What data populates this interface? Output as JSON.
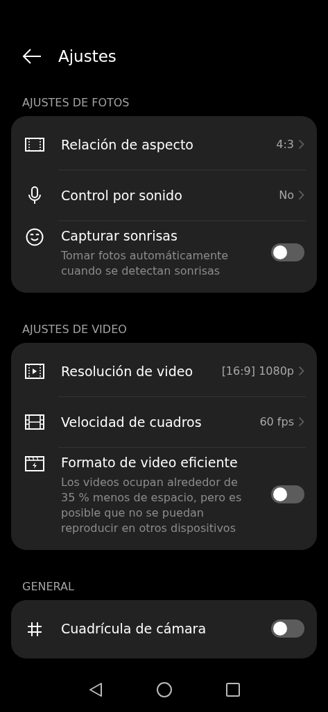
{
  "header": {
    "title": "Ajustes"
  },
  "sections": [
    {
      "title": "AJUSTES DE FOTOS",
      "rows": [
        {
          "kind": "value",
          "label": "Relación de aspecto",
          "value": "4:3"
        },
        {
          "kind": "value",
          "label": "Control por sonido",
          "value": "No"
        },
        {
          "kind": "toggle",
          "label": "Capturar sonrisas",
          "description": "Tomar fotos automáticamente cuando se detectan sonrisas",
          "on": false
        }
      ]
    },
    {
      "title": "AJUSTES DE VIDEO",
      "rows": [
        {
          "kind": "value",
          "label": "Resolución de video",
          "value": "[16:9] 1080p"
        },
        {
          "kind": "value",
          "label": "Velocidad de cuadros",
          "value": "60 fps"
        },
        {
          "kind": "toggle",
          "label": "Formato de video eficiente",
          "description": "Los videos ocupan alrededor de 35 % menos de espacio, pero es posible que no se puedan reproducir en otros dispositivos",
          "on": false
        }
      ]
    },
    {
      "title": "GENERAL",
      "rows": [
        {
          "kind": "toggle",
          "label": "Cuadrícula de cámara",
          "on": false
        }
      ]
    }
  ]
}
